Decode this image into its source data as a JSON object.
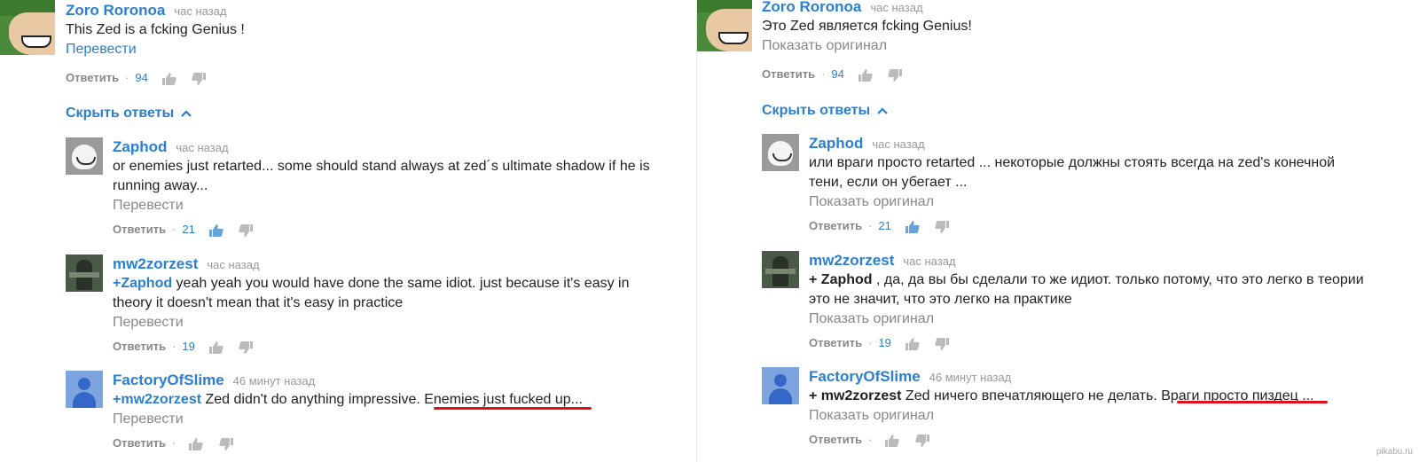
{
  "labels_en": {
    "translate": "Перевести",
    "reply": "Ответить",
    "hide_replies": "Скрыть ответы"
  },
  "labels_ru": {
    "show_original": "Показать оригинал",
    "reply": "Ответить",
    "hide_replies": "Скрыть ответы"
  },
  "left": {
    "top": {
      "author": "Zoro Roronoa",
      "time": "час назад",
      "text": "This Zed is a fcking Genius !",
      "likes": "94"
    },
    "r1": {
      "author": "Zaphod",
      "time": "час назад",
      "text": "or enemies just retarted... some should stand always at zed´s ultimate shadow if he is running away...",
      "likes": "21"
    },
    "r2": {
      "author": "mw2zorzest",
      "time": "час назад",
      "mention": "+Zaphod",
      "text": " yeah yeah you would have done the same idiot. just because it's easy in theory it doesn't mean that it's easy in practice",
      "likes": "19"
    },
    "r3": {
      "author": "FactoryOfSlime",
      "time": "46 минут назад",
      "mention": "+mw2zorzest",
      "text_a": " Zed didn't do anything impressive. ",
      "text_b": "Enemies just fucked up",
      "text_c": "..."
    }
  },
  "right": {
    "top": {
      "author": "Zoro Roronoa",
      "time": "час назад",
      "text": "Это Zed является fcking Genius!",
      "likes": "94"
    },
    "r1": {
      "author": "Zaphod",
      "time": "час назад",
      "text": "или враги просто retarted ... некоторые должны стоять всегда на zed's конечной тени, если он убегает ...",
      "likes": "21"
    },
    "r2": {
      "author": "mw2zorzest",
      "time": "час назад",
      "mention": "+ Zaphod",
      "text": " , да, да вы бы сделали то же идиот. только потому, что это легко в теории это не значит, что это легко на практике",
      "likes": "19"
    },
    "r3": {
      "author": "FactoryOfSlime",
      "time": "46 минут назад",
      "mention": "+ mw2zorzest",
      "text_a": " Zed ничего впечатляющего не делать. ",
      "text_b": "Враги просто пиздец",
      "text_c": " ..."
    }
  },
  "watermark": "pikabu.ru",
  "colors": {
    "link": "#2a7fd0",
    "muted": "#888888",
    "underline": "#e0101a"
  }
}
